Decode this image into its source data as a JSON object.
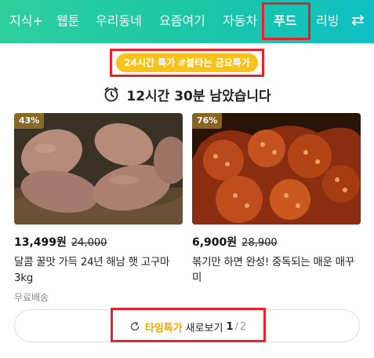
{
  "nav": {
    "items": [
      {
        "label": "지식+"
      },
      {
        "label": "웹툰"
      },
      {
        "label": "우리동네"
      },
      {
        "label": "요즘여기"
      },
      {
        "label": "자동차"
      },
      {
        "label": "푸드"
      },
      {
        "label": "리빙"
      }
    ],
    "active_index": 5,
    "more_icon": "swap-arrows-icon"
  },
  "deal": {
    "badge": "24시간 특가 #불타는 금요특가",
    "countdown": "12시간 30분 남았습니다",
    "clock_icon": "alarm-clock-icon"
  },
  "products": [
    {
      "discount": "43%",
      "price": "13,499원",
      "original_price": "24,000",
      "title": "달콤 꿀맛 가득 24년 해남 햇 고구마 3kg",
      "shipping": "무료배송"
    },
    {
      "discount": "76%",
      "price": "6,900원",
      "original_price": "28,900",
      "title": "볶기만 하면 완성! 중독되는 매운 매꾸미",
      "shipping": ""
    }
  ],
  "more_button": {
    "highlight": "타임특가",
    "label": "새로보기",
    "page": "1",
    "separator": "/",
    "total": "2",
    "icon": "refresh-icon"
  },
  "colors": {
    "nav_gradient_start": "#2fcf9c",
    "nav_gradient_end": "#10bfc4",
    "badge_bg": "#f7c31a",
    "highlight_text": "#f0a800",
    "annotation_red": "#e8222a"
  }
}
